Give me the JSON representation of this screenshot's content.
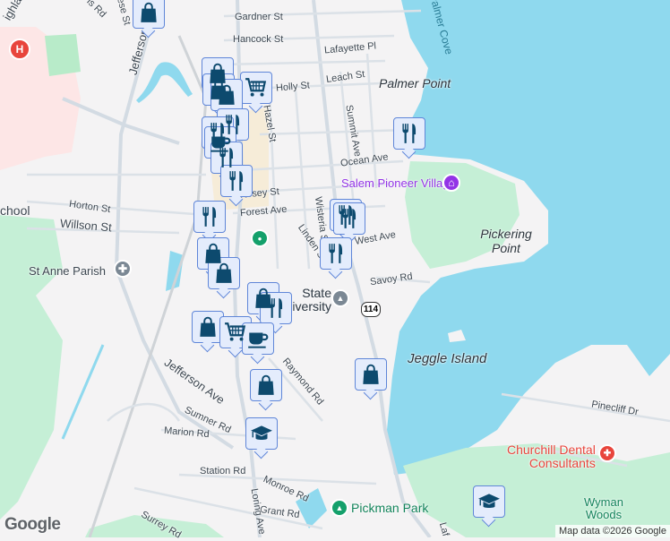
{
  "map": {
    "colors": {
      "water": "#8fd9ee",
      "land": "#f4f3f4",
      "park": "#c5efd6",
      "hospital": "#fde6e6",
      "road": "#d6dde4",
      "marker_bg": "#e4ecfc",
      "marker_border": "#5f86d8",
      "marker_icon": "#0d4a6e"
    },
    "places": {
      "palmer_point": "Palmer Point",
      "palmer_cove": "Palmer Cove",
      "pickering_point": "Pickering Point",
      "jeggle_island": "Jeggle Island",
      "salem_pioneer_village": "Salem Pioneer Village",
      "st_anne_parish": "St Anne Parish",
      "state_university": "State\nUniversity",
      "state_university_1": "State",
      "state_university_2": "versity",
      "churchill_dental_1": "Churchill Dental",
      "churchill_dental_2": "Consultants",
      "pickman_park": "Pickman Park",
      "wyman_woods_1": "Wyman",
      "wyman_woods_2": "Woods",
      "school": "chool"
    },
    "streets": {
      "gardner": "Gardner St",
      "hancock": "Hancock St",
      "lafayette_pl": "Lafayette Pl",
      "holly": "Holly St",
      "leach": "Leach St",
      "hazel": "Hazel St",
      "summit": "Summit Ave",
      "ocean": "Ocean Ave",
      "jersey": "Jersey St",
      "forest": "Forest Ave",
      "wisteria": "Wisteria St",
      "linden": "Linden St",
      "west": "West Ave",
      "savoy": "Savoy Rd",
      "horton": "Horton St",
      "willson": "Willson St",
      "jefferson_n": "Jefferson",
      "jefferson_ave": "Jefferson Ave",
      "raymond": "Raymond Rd",
      "sumner": "Sumner Rd",
      "marion": "Marion Rd",
      "station": "Station Rd",
      "monroe": "Monroe Rd",
      "grant": "Grant Rd",
      "surrey": "Surrey Rd",
      "loring": "Loring Ave",
      "pinecliff": "Pinecliff Dr",
      "lafayette": "Laf",
      "route": "114",
      "rd_nw": "ls Rd",
      "rese": "rese St",
      "highland": "ighla"
    },
    "markers": [
      "shopping",
      "shopping",
      "shopping",
      "cart",
      "shopping",
      "restaurant",
      "restaurant",
      "cafe",
      "restaurant",
      "restaurant",
      "restaurant",
      "shopping",
      "shopping",
      "restaurant",
      "restaurant",
      "restaurant",
      "restaurant",
      "shopping",
      "restaurant",
      "shopping",
      "cart",
      "cafe",
      "shopping",
      "school",
      "shopping",
      "school"
    ],
    "attribution": "Map data ©2026 Google",
    "logo": "Google"
  }
}
